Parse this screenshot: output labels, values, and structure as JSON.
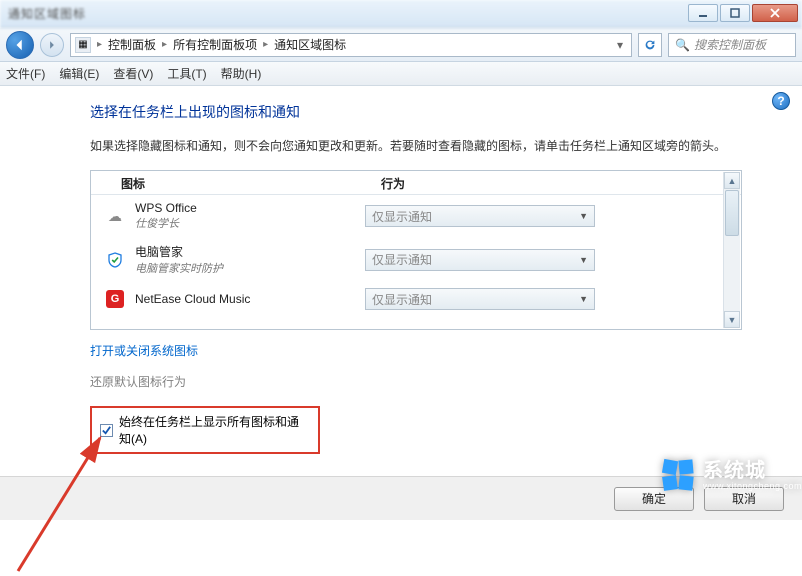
{
  "window": {
    "title_blur": "通知区域图标"
  },
  "nav": {
    "breadcrumb": [
      "控制面板",
      "所有控制面板项",
      "通知区域图标"
    ],
    "search_placeholder": "搜索控制面板"
  },
  "menu": {
    "file": "文件(F)",
    "edit": "编辑(E)",
    "view": "查看(V)",
    "tools": "工具(T)",
    "help": "帮助(H)"
  },
  "page": {
    "heading": "选择在任务栏上出现的图标和通知",
    "description": "如果选择隐藏图标和通知，则不会向您通知更改和更新。若要随时查看隐藏的图标，请单击任务栏上通知区域旁的箭头。",
    "col_icon": "图标",
    "col_behavior": "行为",
    "items": [
      {
        "name": "WPS Office",
        "sub": "仕俊学长",
        "behavior": "仅显示通知",
        "icon": "wps"
      },
      {
        "name": "电脑管家",
        "sub": "电脑管家实时防护",
        "behavior": "仅显示通知",
        "icon": "shield"
      },
      {
        "name": "NetEase Cloud Music",
        "sub": "",
        "behavior": "仅显示通知",
        "icon": "netease"
      }
    ],
    "link_system_icons": "打开或关闭系统图标",
    "link_restore": "还原默认图标行为",
    "checkbox_label": "始终在任务栏上显示所有图标和通知(A)",
    "checkbox_checked": true
  },
  "buttons": {
    "ok": "确定",
    "cancel": "取消"
  },
  "watermark": {
    "brand": "系统城",
    "url": "www.xitongcheng.com"
  }
}
